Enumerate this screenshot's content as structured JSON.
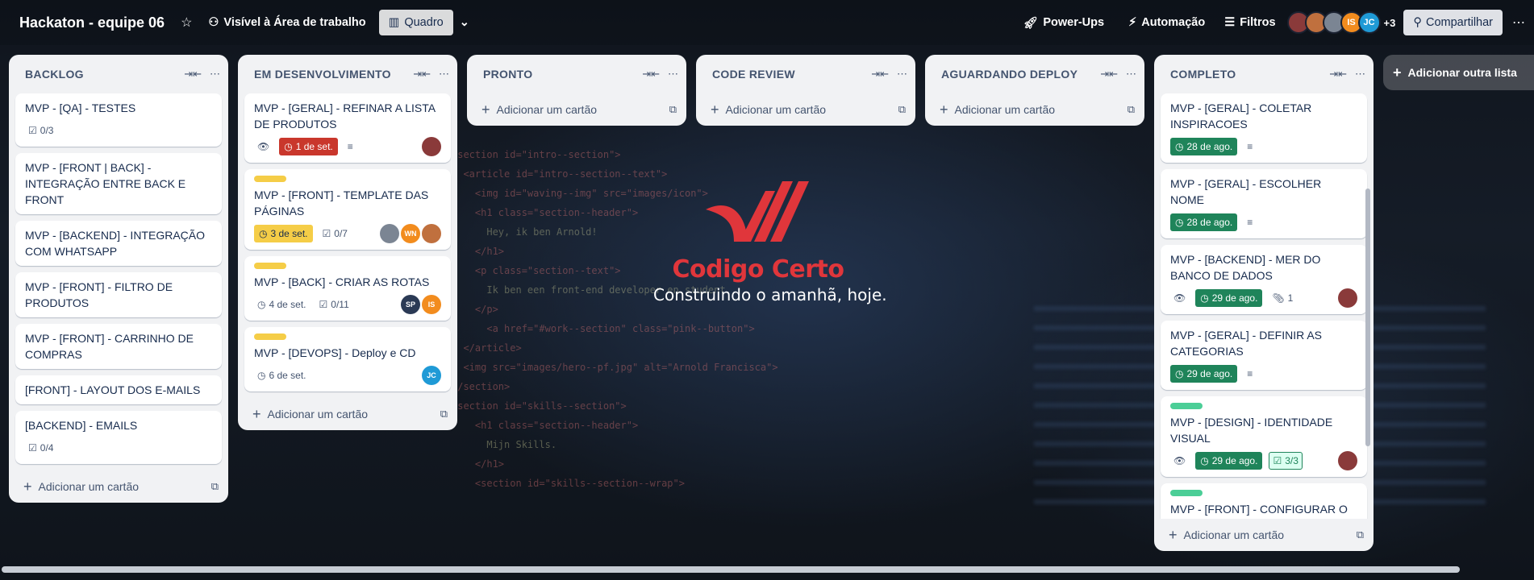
{
  "header": {
    "title": "Hackaton - equipe 06",
    "visibility": "Visível à Área de trabalho",
    "view": "Quadro",
    "powerups": "Power-Ups",
    "automation": "Automação",
    "filters": "Filtros",
    "members_extra": "+3",
    "share": "Compartilhar",
    "avatars": [
      {
        "initials": "",
        "color": "#8a3a3a"
      },
      {
        "initials": "",
        "color": "#c0703e"
      },
      {
        "initials": "",
        "color": "#7b8593"
      },
      {
        "initials": "IS",
        "color": "#f28c1e"
      },
      {
        "initials": "JC",
        "color": "#1f9ad6"
      }
    ]
  },
  "logo": {
    "title": "Codigo Certo",
    "subtitle": "Construindo o amanhã, hoje."
  },
  "add_card_label": "Adicionar um cartão",
  "add_list_label": "Adicionar outra lista",
  "lists": [
    {
      "title": "BACKLOG",
      "cards": [
        {
          "title": "MVP - [QA] - TESTES",
          "checklist": "0/3"
        },
        {
          "title": "MVP - [FRONT | BACK] - INTEGRAÇÃO ENTRE BACK E FRONT"
        },
        {
          "title": "MVP - [BACKEND] - INTEGRAÇÃO COM WHATSAPP"
        },
        {
          "title": "MVP - [FRONT] - FILTRO DE PRODUTOS"
        },
        {
          "title": "MVP - [FRONT] - CARRINHO DE COMPRAS"
        },
        {
          "title": "[FRONT] - LAYOUT DOS E-MAILS"
        },
        {
          "title": "[BACKEND] - EMAILS",
          "checklist": "0/4"
        }
      ]
    },
    {
      "title": "EM DESENVOLVIMENTO",
      "cards": [
        {
          "title": "MVP - [GERAL] - REFINAR A LISTA DE PRODUTOS",
          "due": "1 de set.",
          "due_style": "red",
          "watch": true,
          "desc": true,
          "members": [
            {
              "initials": "",
              "color": "#8a3a3a"
            }
          ]
        },
        {
          "title": "MVP - [FRONT] - TEMPLATE DAS PÁGINAS",
          "label": "#f5cd47",
          "due": "3 de set.",
          "due_style": "yellow",
          "checklist": "0/7",
          "members": [
            {
              "initials": "",
              "color": "#7b8593"
            },
            {
              "initials": "WN",
              "color": "#f28c1e"
            },
            {
              "initials": "",
              "color": "#c0703e"
            }
          ]
        },
        {
          "title": "MVP - [BACK] - CRIAR AS ROTAS",
          "label": "#f5cd47",
          "due": "4 de set.",
          "due_style": "plain",
          "checklist": "0/11",
          "members": [
            {
              "initials": "SP",
              "color": "#2b3a55"
            },
            {
              "initials": "IS",
              "color": "#f28c1e"
            }
          ]
        },
        {
          "title": "MVP - [DEVOPS] - Deploy e CD",
          "label": "#f5cd47",
          "due": "6 de set.",
          "due_style": "plain",
          "members": [
            {
              "initials": "JC",
              "color": "#1f9ad6"
            }
          ]
        }
      ]
    },
    {
      "title": "PRONTO",
      "cards": []
    },
    {
      "title": "CODE REVIEW",
      "cards": []
    },
    {
      "title": "AGUARDANDO DEPLOY",
      "cards": []
    },
    {
      "title": "COMPLETO",
      "cards": [
        {
          "title": "MVP - [GERAL] - COLETAR INSPIRACOES",
          "due": "28 de ago.",
          "due_style": "green",
          "desc": true
        },
        {
          "title": "MVP - [GERAL] - ESCOLHER NOME",
          "due": "28 de ago.",
          "due_style": "green",
          "desc": true
        },
        {
          "title": "MVP - [BACKEND] - MER DO BANCO DE DADOS",
          "due": "29 de ago.",
          "due_style": "green",
          "watch": true,
          "attachments": "1",
          "members": [
            {
              "initials": "",
              "color": "#8a3a3a"
            }
          ]
        },
        {
          "title": "MVP - [GERAL] - DEFINIR AS CATEGORIAS",
          "due": "29 de ago.",
          "due_style": "green",
          "desc": true
        },
        {
          "title": "MVP - [DESIGN] - IDENTIDADE VISUAL",
          "label": "#4bce97",
          "due": "29 de ago.",
          "due_style": "green",
          "watch": true,
          "checklist": "3/3",
          "checklist_done": true,
          "members": [
            {
              "initials": "",
              "color": "#8a3a3a"
            }
          ]
        },
        {
          "title": "MVP - [FRONT] - CONFIGURAR O AMBIENTE",
          "label": "#4bce97"
        }
      ]
    }
  ]
}
